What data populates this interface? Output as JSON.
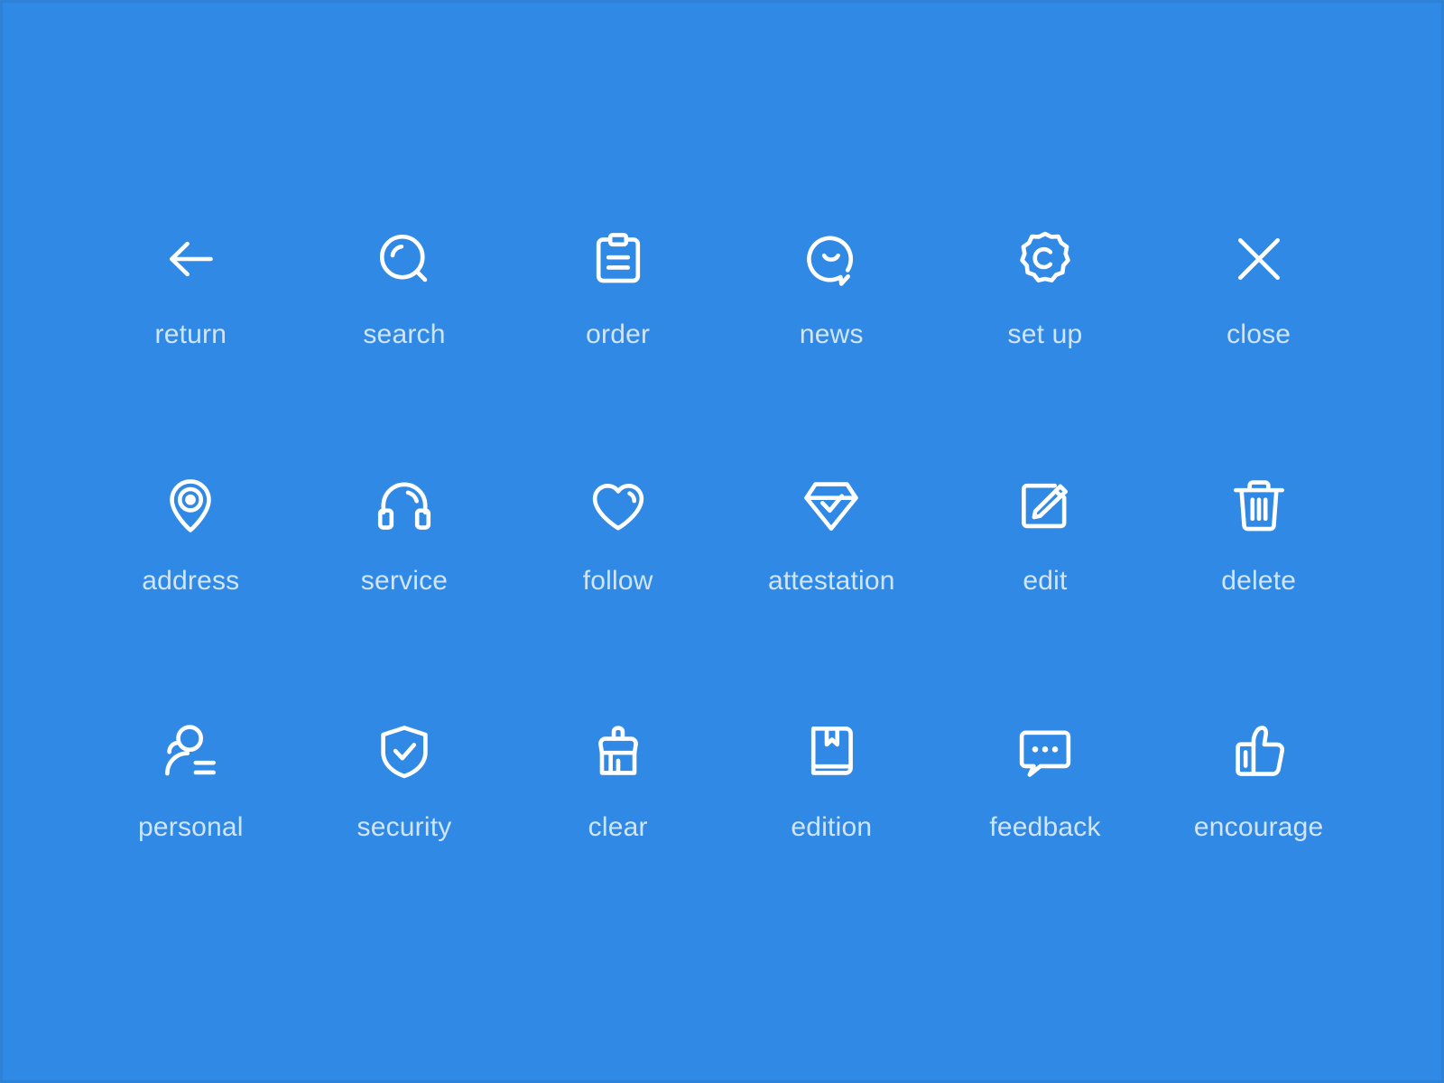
{
  "canvas": {
    "background_color": "#3089e4",
    "icon_color": "#ffffff",
    "label_color": "rgba(255,255,255,0.78)"
  },
  "grid": {
    "columns": 6,
    "rows": 3,
    "icons": [
      {
        "icon": "arrow-left-icon",
        "label": "return"
      },
      {
        "icon": "magnifier-icon",
        "label": "search"
      },
      {
        "icon": "clipboard-icon",
        "label": "order"
      },
      {
        "icon": "speech-bubble-smile-icon",
        "label": "news"
      },
      {
        "icon": "badge-gear-c-icon",
        "label": "set up"
      },
      {
        "icon": "close-x-icon",
        "label": "close"
      },
      {
        "icon": "map-pin-icon",
        "label": "address"
      },
      {
        "icon": "headphones-icon",
        "label": "service"
      },
      {
        "icon": "heart-icon",
        "label": "follow"
      },
      {
        "icon": "diamond-check-icon",
        "label": "attestation"
      },
      {
        "icon": "pencil-square-icon",
        "label": "edit"
      },
      {
        "icon": "trash-icon",
        "label": "delete"
      },
      {
        "icon": "person-lines-icon",
        "label": "personal"
      },
      {
        "icon": "shield-check-icon",
        "label": "security"
      },
      {
        "icon": "broom-icon",
        "label": "clear"
      },
      {
        "icon": "book-bookmark-icon",
        "label": "edition"
      },
      {
        "icon": "speech-bubble-dots-icon",
        "label": "feedback"
      },
      {
        "icon": "thumbs-up-icon",
        "label": "encourage"
      }
    ]
  }
}
